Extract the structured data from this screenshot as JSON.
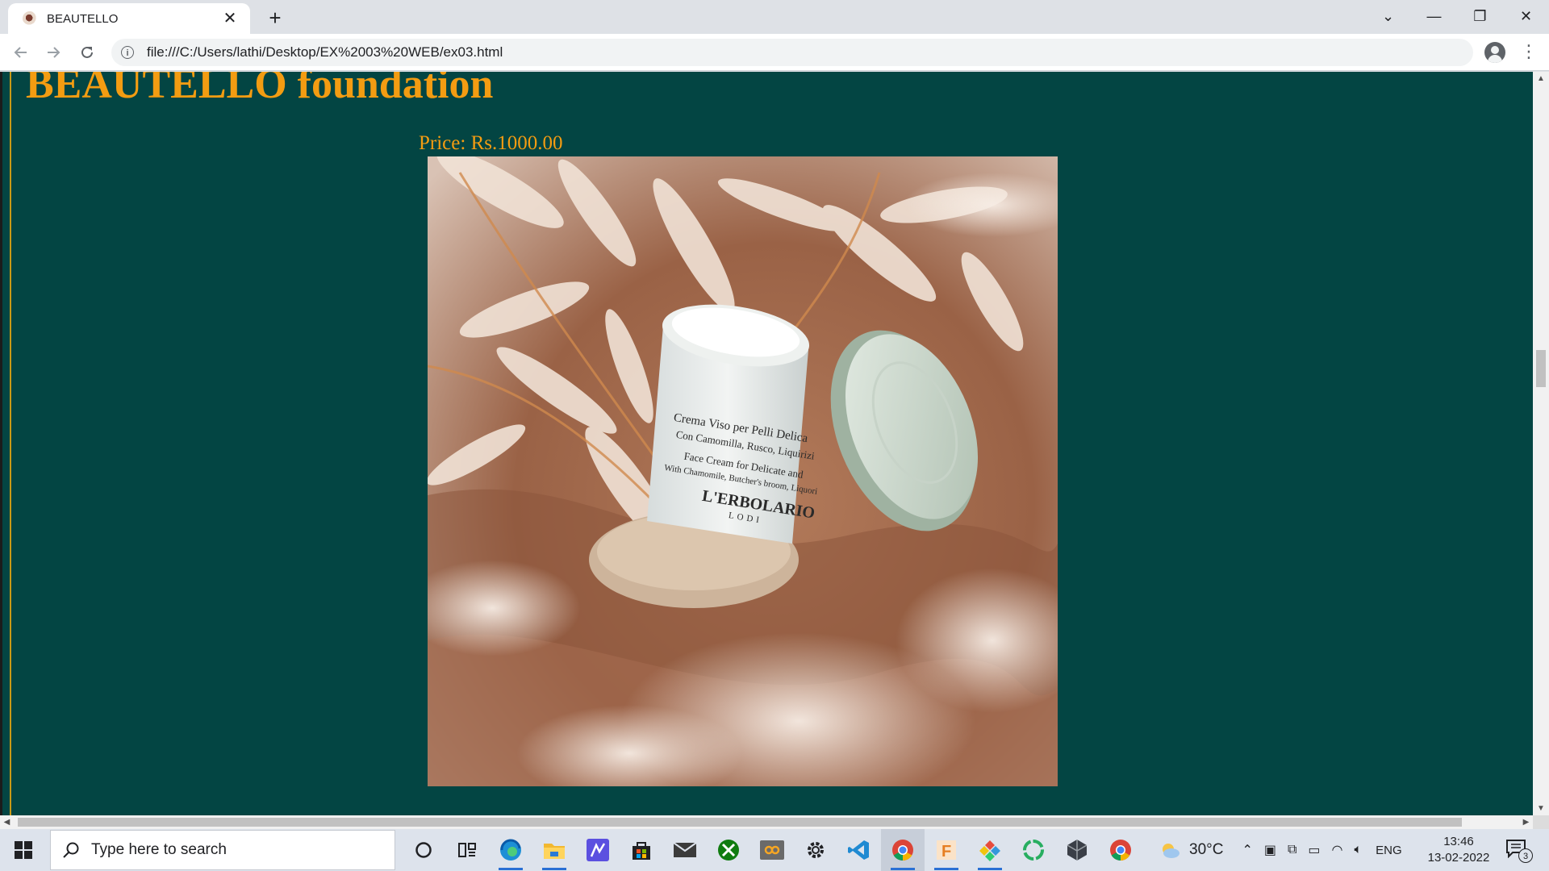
{
  "browser": {
    "tab_title": "BEAUTELLO",
    "tab_close": "✕",
    "new_tab": "+",
    "url": "file:///C:/Users/lathi/Desktop/EX%2003%20WEB/ex03.html",
    "window_controls": [
      "⌄",
      "—",
      "❐",
      "✕"
    ]
  },
  "page": {
    "heading": "BEAUTELLO foundation",
    "price": "Price: Rs.1000.00",
    "product_image": {
      "jar_text_lines": [
        "Crema Viso per Pelli Delica",
        "Con Camomilla, Rusco, Liquirizi",
        "Face Cream for Delicate and",
        "With Chamomile, Butcher's broom, Liquori"
      ],
      "brand": "L'ERBOLARIO",
      "city": "LODI"
    },
    "colors": {
      "background": "#034543",
      "text": "#f39c12"
    }
  },
  "taskbar": {
    "search_placeholder": "Type here to search",
    "pinned_apps": [
      "cortana-icon",
      "task-view-icon",
      "edge-icon",
      "file-explorer-icon",
      "app-icon",
      "store-icon",
      "mail-icon",
      "xbox-icon",
      "app-icon",
      "settings-icon",
      "vscode-icon",
      "chrome-icon",
      "app-icon",
      "app-icon",
      "app-icon",
      "app-icon",
      "chrome-icon"
    ],
    "weather": "30°C",
    "language": "ENG",
    "time": "13:46",
    "date": "13-02-2022",
    "notification_count": "3"
  }
}
